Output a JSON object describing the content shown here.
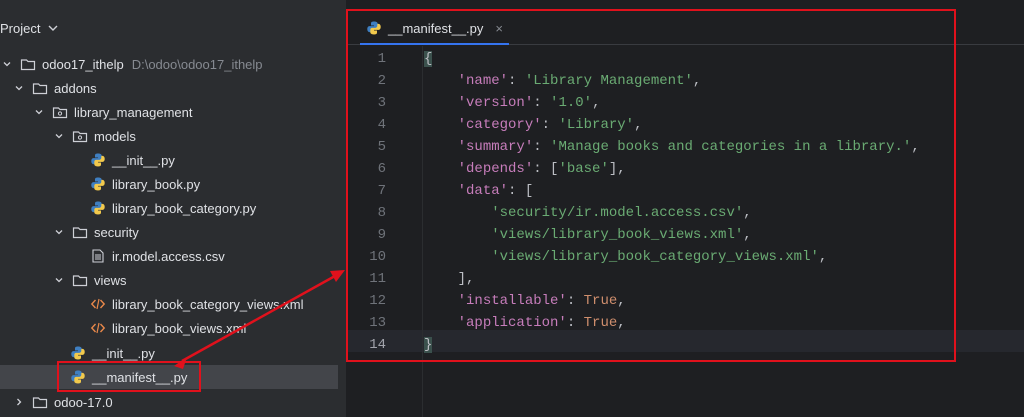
{
  "project_panel": {
    "title": "Project",
    "tree": [
      {
        "id": "root",
        "label": "odoo17_ithelp",
        "path": "D:\\odoo\\odoo17_ithelp",
        "icon": "folder-icon"
      },
      {
        "id": "addons",
        "label": "addons",
        "icon": "folder-icon"
      },
      {
        "id": "library_management",
        "label": "library_management",
        "icon": "package-folder-icon"
      },
      {
        "id": "models",
        "label": "models",
        "icon": "package-folder-icon"
      },
      {
        "id": "init_models",
        "label": "__init__.py",
        "icon": "python-file-icon"
      },
      {
        "id": "library_book",
        "label": "library_book.py",
        "icon": "python-file-icon"
      },
      {
        "id": "library_book_category",
        "label": "library_book_category.py",
        "icon": "python-file-icon"
      },
      {
        "id": "security",
        "label": "security",
        "icon": "folder-icon"
      },
      {
        "id": "ir_model_access",
        "label": "ir.model.access.csv",
        "icon": "csv-file-icon"
      },
      {
        "id": "views",
        "label": "views",
        "icon": "folder-icon"
      },
      {
        "id": "category_views_xml",
        "label": "library_book_category_views.xml",
        "icon": "xml-file-icon"
      },
      {
        "id": "book_views_xml",
        "label": "library_book_views.xml",
        "icon": "xml-file-icon"
      },
      {
        "id": "init_lib",
        "label": "__init__.py",
        "icon": "python-file-icon"
      },
      {
        "id": "manifest",
        "label": "__manifest__.py",
        "icon": "python-file-icon"
      },
      {
        "id": "odoo17",
        "label": "odoo-17.0",
        "icon": "folder-icon"
      }
    ]
  },
  "editor": {
    "tab_label": "__manifest__.py",
    "tab_close": "×",
    "line_numbers": [
      "1",
      "2",
      "3",
      "4",
      "5",
      "6",
      "7",
      "8",
      "9",
      "10",
      "11",
      "12",
      "13",
      "14"
    ],
    "current_line": "14",
    "code": {
      "l1": "{",
      "l2_key": "'name'",
      "l2_val": "'Library Management'",
      "l3_key": "'version'",
      "l3_val": "'1.0'",
      "l4_key": "'category'",
      "l4_val": "'Library'",
      "l5_key": "'summary'",
      "l5_val": "'Manage books and categories in a library.'",
      "l6_key": "'depends'",
      "l6_val": "'base'",
      "l7_key": "'data'",
      "l8_val": "'security/ir.model.access.csv'",
      "l9_val": "'views/library_book_views.xml'",
      "l10_val": "'views/library_book_category_views.xml'",
      "l11": "],",
      "l12_key": "'installable'",
      "l12_val": "True",
      "l13_key": "'application'",
      "l13_val": "True",
      "l14": "}"
    }
  },
  "colors": {
    "annotation_red": "#e0111c",
    "string_green": "#6aab73",
    "keyword_orange": "#cf8e6d",
    "dict_key_purple": "#c77dbb"
  }
}
